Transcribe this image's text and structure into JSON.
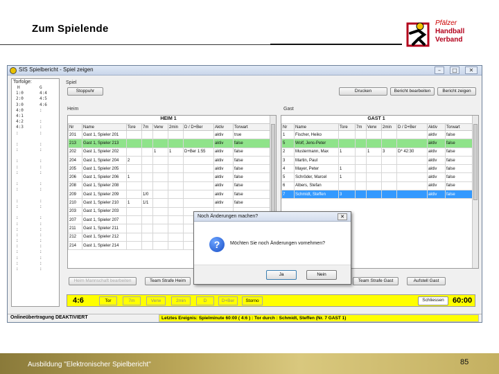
{
  "slide": {
    "title": "Zum Spielende",
    "logo_line1": "Pfälzer",
    "logo_line2": "Handball",
    "logo_line3": "Verband",
    "footer_text": "Ausbildung \"Elektronischer Spielbericht\"",
    "page_number": "85"
  },
  "window": {
    "title": "SIS Spielbericht - Spiel zeigen",
    "min_label": "–",
    "max_label": "□",
    "close_label": "✕"
  },
  "left_panel": {
    "header": "Torfolge:",
    "col1": "H",
    "col2": "G",
    "rows": [
      [
        "1:0",
        "4:4"
      ],
      [
        "2:0",
        "4:5"
      ],
      [
        "3:0",
        "4:6"
      ],
      [
        "4:0",
        ":"
      ],
      [
        "4:1",
        ""
      ],
      [
        "4:2",
        ":"
      ],
      [
        "4:3",
        ":"
      ],
      [
        ":",
        ":"
      ],
      [
        "",
        ""
      ],
      [
        ":",
        ":"
      ],
      [
        ":",
        ":"
      ],
      [
        "",
        ""
      ],
      [
        ":",
        ":"
      ],
      [
        ":",
        ":"
      ],
      [
        ":",
        ":"
      ],
      [
        "",
        ""
      ],
      [
        ":",
        ":"
      ],
      [
        ":",
        ":"
      ],
      [
        "",
        ""
      ],
      [
        ":",
        ":"
      ],
      [
        ":",
        ":"
      ],
      [
        "",
        ""
      ],
      [
        ":",
        ":"
      ],
      [
        ":",
        ":"
      ],
      [
        ":",
        ":"
      ],
      [
        ":",
        ":"
      ],
      [
        ":",
        ":"
      ],
      [
        ":",
        ":"
      ],
      [
        ":",
        ":"
      ],
      [
        ":",
        ":"
      ],
      [
        ":",
        ":"
      ],
      [
        ":",
        ":"
      ]
    ]
  },
  "toolbar": {
    "spiel_label": "Spiel",
    "stoppuhr": "Stoppuhr",
    "drucken": "Drucken",
    "bearbeiten": "Bericht bearbeiten",
    "zeigen": "Bericht zeigen"
  },
  "heim": {
    "group_label": "Heim",
    "team": "HEIM 1",
    "columns": [
      "Nr",
      "Name",
      "Tore",
      "7m",
      "Verw",
      "2min",
      "D / D+Ber",
      "Aktiv",
      "Torwart"
    ],
    "rows": [
      {
        "nr": "201",
        "name": "Gast 1, Spieler 201",
        "tore": "",
        "m7": "",
        "verw": "",
        "min2": "",
        "dis": "",
        "aktiv": "aktiv",
        "tw": "true",
        "style": ""
      },
      {
        "nr": "213",
        "name": "Gast 1, Spieler 213",
        "tore": "",
        "m7": "",
        "verw": "",
        "min2": "",
        "dis": "",
        "aktiv": "aktiv",
        "tw": "false",
        "style": "green"
      },
      {
        "nr": "202",
        "name": "Gast 1, Spieler 202",
        "tore": "",
        "m7": "",
        "verw": "1",
        "min2": "1",
        "dis": "D+Ber 1:55",
        "aktiv": "aktiv",
        "tw": "false",
        "style": ""
      },
      {
        "nr": "204",
        "name": "Gast 1, Spieler 204",
        "tore": "2",
        "m7": "",
        "verw": "",
        "min2": "",
        "dis": "",
        "aktiv": "aktiv",
        "tw": "false",
        "style": ""
      },
      {
        "nr": "205",
        "name": "Gast 1, Spieler 205",
        "tore": "",
        "m7": "",
        "verw": "",
        "min2": "",
        "dis": "",
        "aktiv": "aktiv",
        "tw": "false",
        "style": ""
      },
      {
        "nr": "206",
        "name": "Gast 1, Spieler 206",
        "tore": "1",
        "m7": "",
        "verw": "",
        "min2": "",
        "dis": "",
        "aktiv": "aktiv",
        "tw": "false",
        "style": ""
      },
      {
        "nr": "208",
        "name": "Gast 1, Spieler 208",
        "tore": "",
        "m7": "",
        "verw": "",
        "min2": "",
        "dis": "",
        "aktiv": "aktiv",
        "tw": "false",
        "style": ""
      },
      {
        "nr": "209",
        "name": "Gast 1, Spieler 209",
        "tore": "",
        "m7": "1/0",
        "verw": "",
        "min2": "",
        "dis": "",
        "aktiv": "aktiv",
        "tw": "false",
        "style": ""
      },
      {
        "nr": "210",
        "name": "Gast 1, Spieler 210",
        "tore": "1",
        "m7": "1/1",
        "verw": "",
        "min2": "",
        "dis": "",
        "aktiv": "aktiv",
        "tw": "false",
        "style": ""
      },
      {
        "nr": "203",
        "name": "Gast 1, Spieler 203",
        "tore": "",
        "m7": "",
        "verw": "",
        "min2": "",
        "dis": "",
        "aktiv": "",
        "tw": "",
        "style": ""
      },
      {
        "nr": "207",
        "name": "Gast 1, Spieler 207",
        "tore": "",
        "m7": "",
        "verw": "",
        "min2": "",
        "dis": "",
        "aktiv": "",
        "tw": "",
        "style": ""
      },
      {
        "nr": "211",
        "name": "Gast 1, Spieler 211",
        "tore": "",
        "m7": "",
        "verw": "",
        "min2": "",
        "dis": "",
        "aktiv": "",
        "tw": "",
        "style": ""
      },
      {
        "nr": "212",
        "name": "Gast 1, Spieler 212",
        "tore": "",
        "m7": "",
        "verw": "",
        "min2": "",
        "dis": "",
        "aktiv": "",
        "tw": "",
        "style": ""
      },
      {
        "nr": "214",
        "name": "Gast 1, Spieler 214",
        "tore": "",
        "m7": "",
        "verw": "",
        "min2": "",
        "dis": "",
        "aktiv": "",
        "tw": "",
        "style": ""
      }
    ],
    "btn_mannschaft": "Heim Mannschaft bearbeiten",
    "btn_strafe": "Team Strafe Heim"
  },
  "gast": {
    "group_label": "Gast",
    "team": "GAST 1",
    "columns": [
      "Nr",
      "Name",
      "Tore",
      "7m",
      "Verw",
      "2min",
      "D / D+Ber",
      "Aktiv",
      "Torwart"
    ],
    "rows": [
      {
        "nr": "1",
        "name": "Fischer, Heiko",
        "tore": "",
        "m7": "",
        "verw": "",
        "min2": "",
        "dis": "",
        "aktiv": "aktiv",
        "tw": "false",
        "style": ""
      },
      {
        "nr": "5",
        "name": "Wolf, Jens-Peter",
        "tore": "",
        "m7": "",
        "verw": "",
        "min2": "",
        "dis": "",
        "aktiv": "aktiv",
        "tw": "false",
        "style": "green"
      },
      {
        "nr": "2",
        "name": "Mustermann, Max",
        "tore": "1",
        "m7": "",
        "verw": "1",
        "min2": "3",
        "dis": "D* 42:30",
        "aktiv": "aktiv",
        "tw": "false",
        "style": ""
      },
      {
        "nr": "3",
        "name": "Martin, Paul",
        "tore": "",
        "m7": "",
        "verw": "",
        "min2": "",
        "dis": "",
        "aktiv": "aktiv",
        "tw": "false",
        "style": ""
      },
      {
        "nr": "4",
        "name": "Mayer, Peter",
        "tore": "1",
        "m7": "",
        "verw": "",
        "min2": "",
        "dis": "",
        "aktiv": "aktiv",
        "tw": "false",
        "style": ""
      },
      {
        "nr": "5",
        "name": "Schröder, Marcel",
        "tore": "1",
        "m7": "",
        "verw": "",
        "min2": "",
        "dis": "",
        "aktiv": "aktiv",
        "tw": "false",
        "style": ""
      },
      {
        "nr": "6",
        "name": "Albers, Stefan",
        "tore": "",
        "m7": "",
        "verw": "",
        "min2": "",
        "dis": "",
        "aktiv": "aktiv",
        "tw": "false",
        "style": ""
      },
      {
        "nr": "7",
        "name": "Schmidt, Steffen",
        "tore": "3",
        "m7": "",
        "verw": "",
        "min2": "",
        "dis": "",
        "aktiv": "aktiv",
        "tw": "false",
        "style": "blue"
      }
    ],
    "btn_strafe": "Team Strafe Gast",
    "btn_aufstellung": "Aufstell Gast"
  },
  "scorebar": {
    "score": "4:6",
    "tor": "Tor",
    "m7": "7m",
    "verw": "Verw",
    "min2": "2min",
    "d": "D",
    "dber": "D+Ber",
    "stornol": "Storno",
    "schliessen": "Schliessen",
    "time": "60:00"
  },
  "statusbar": {
    "left": "Onlineübertragung DEAKTIVIERT",
    "right": "Letztes Ereignis: Spielminute 60:00 ( 4:6 ) : Tor durch : Schmidt, Steffen (Nr. 7 GAST 1)"
  },
  "dialog": {
    "title": "Noch Änderungen machen?",
    "close": "✕",
    "message": "Möchten Sie noch Änderungen vornehmen?",
    "ja": "Ja",
    "nein": "Nein"
  },
  "colors": {
    "highlight_green": "#8fe38a",
    "highlight_blue": "#3399ff",
    "scorebar_yellow": "#ffff00"
  }
}
